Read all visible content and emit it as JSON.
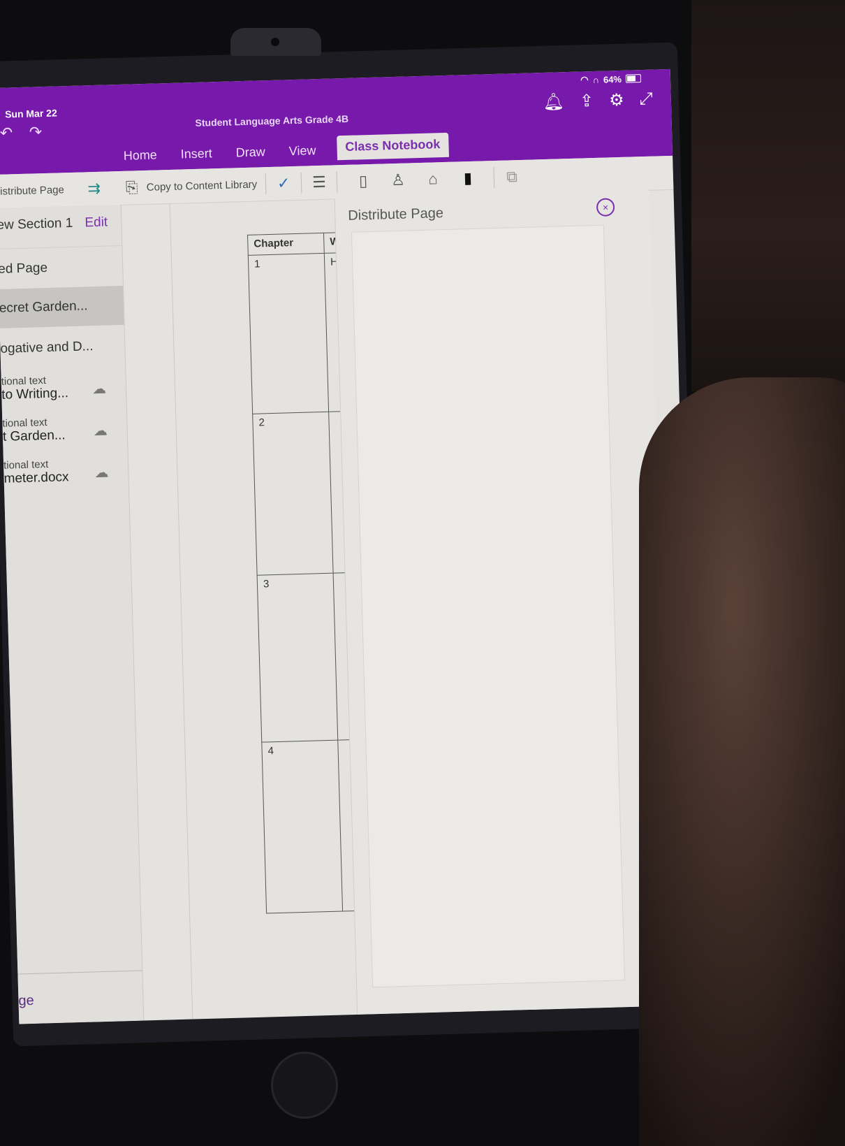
{
  "status_bar": {
    "date": "Sun Mar 22",
    "battery": "64%"
  },
  "app": {
    "document_title": "Student Language Arts Grade 4B",
    "tabs": [
      {
        "label": "Home",
        "active": false
      },
      {
        "label": "Insert",
        "active": false
      },
      {
        "label": "Draw",
        "active": false
      },
      {
        "label": "View",
        "active": false
      },
      {
        "label": "Class Notebook",
        "active": true
      }
    ],
    "accent_color": "#7719aa"
  },
  "ribbon": {
    "distribute_page_label": "istribute Page",
    "copy_to_content_library_label": "Copy to Content Library"
  },
  "sidebar": {
    "section_title": "ew Section 1",
    "edit_label": "Edit",
    "pages": [
      {
        "title": "ed Page",
        "selected": false
      },
      {
        "title": "ecret Garden...",
        "selected": true
      },
      {
        "title": "ogative and D...",
        "selected": false
      }
    ],
    "attachments": [
      {
        "caption": "tional text",
        "name": "to Writing..."
      },
      {
        "caption": "tional text",
        "name": "t Garden..."
      },
      {
        "caption": "tional text",
        "name": "meter.docx"
      }
    ],
    "bottom_label": "ge"
  },
  "table": {
    "headers": [
      "Chapter",
      "W"
    ],
    "rows": [
      [
        "1",
        "H"
      ],
      [
        "2",
        ""
      ],
      [
        "3",
        ""
      ],
      [
        "4",
        ""
      ]
    ]
  },
  "panel": {
    "title": "Distribute Page",
    "close_icon": "×"
  }
}
